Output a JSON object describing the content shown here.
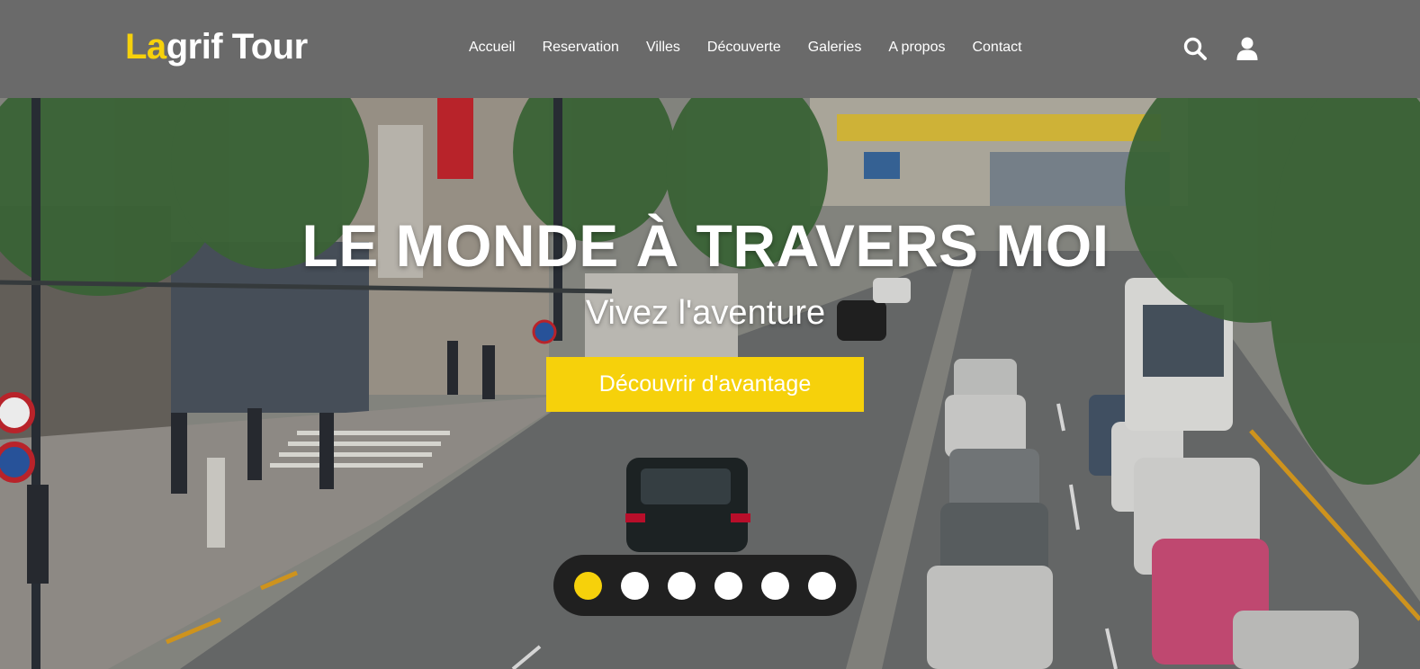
{
  "brand": {
    "prefix": "La",
    "suffix": "grif Tour"
  },
  "nav": {
    "items": [
      {
        "label": "Accueil"
      },
      {
        "label": "Reservation"
      },
      {
        "label": "Villes"
      },
      {
        "label": "Découverte"
      },
      {
        "label": "Galeries"
      },
      {
        "label": "A propos"
      },
      {
        "label": "Contact"
      }
    ]
  },
  "header_icons": {
    "search": "search-icon",
    "user": "user-icon"
  },
  "hero": {
    "title": "LE MONDE À TRAVERS MOI",
    "subtitle": "Vivez l'aventure",
    "cta_label": "Découvrir d'avantage",
    "carousel": {
      "slide_count": 6,
      "active_index": 0
    }
  },
  "colors": {
    "accent": "#f6d10b",
    "header_bg": "#6a6a6a",
    "text": "#ffffff",
    "dots_bg": "#1a1a1a"
  }
}
